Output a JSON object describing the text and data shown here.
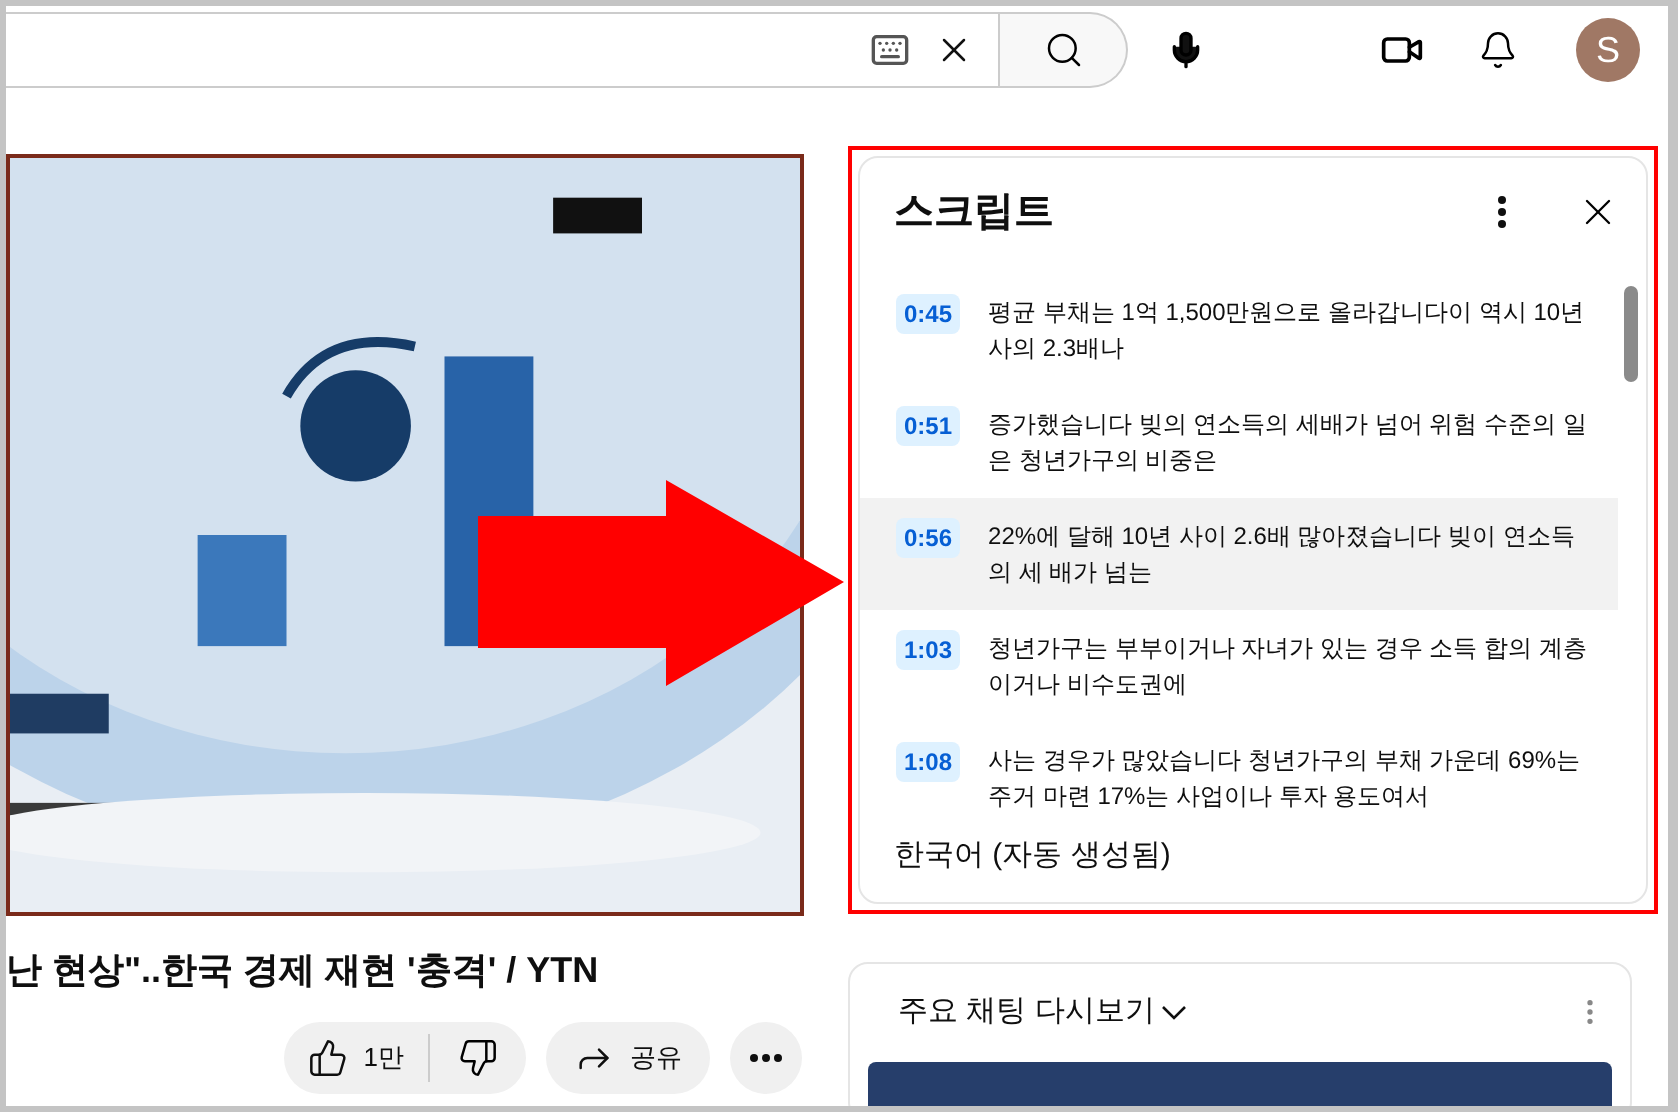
{
  "avatar": {
    "letter": "S"
  },
  "video_title": "난 현상\"..한국 경제 재현 '충격' / YTN",
  "actions": {
    "like_count": "1만",
    "share_label": "공유"
  },
  "transcript": {
    "title": "스크립트",
    "segments": [
      {
        "time": "0:45",
        "text": "평균 부채는 1억 1,500만원으로 올라갑니다이 역시 10년 사의 2.3배나",
        "selected": false
      },
      {
        "time": "0:51",
        "text": "증가했습니다 빚의 연소득의 세배가 넘어 위험 수준의 일은 청년가구의 비중은",
        "selected": false
      },
      {
        "time": "0:56",
        "text": "22%에 달해 10년 사이 2.6배 많아졌습니다 빚이 연소득의 세 배가 넘는",
        "selected": true
      },
      {
        "time": "1:03",
        "text": "청년가구는 부부이거나 자녀가 있는 경우 소득 합의 계층이거나 비수도권에",
        "selected": false
      },
      {
        "time": "1:08",
        "text": "사는 경우가 많았습니다 청년가구의 부채 가운데 69%는 주거 마련 17%는 사업이나 투자 용도여서",
        "selected": false
      }
    ],
    "language": "한국어 (자동 생성됨)"
  },
  "chat_replay": {
    "title": "주요 채팅 다시보기"
  }
}
